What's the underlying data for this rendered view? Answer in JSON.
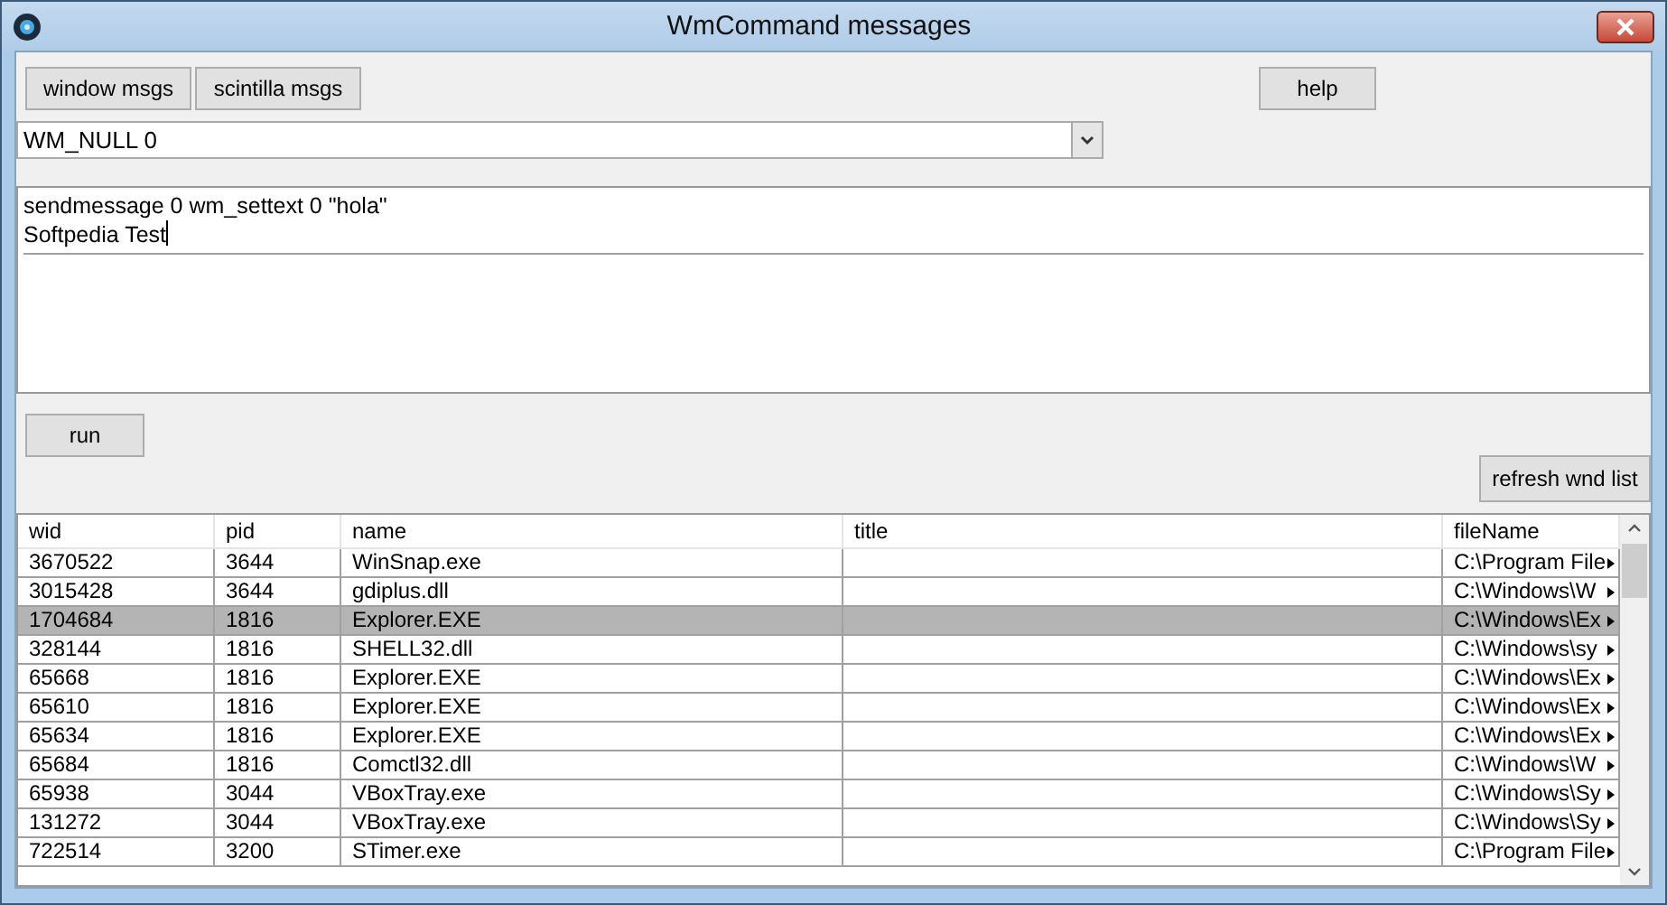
{
  "window": {
    "title": "WmCommand messages"
  },
  "top_buttons": [
    "window msgs",
    "scintilla msgs"
  ],
  "help_button": "help",
  "message_combo": {
    "value": "WM_NULL 0"
  },
  "script_editor": {
    "lines": [
      "sendmessage 0 wm_settext 0 \"hola\"",
      "Softpedia Test"
    ]
  },
  "run_button": "run",
  "refresh_button": "refresh wnd list",
  "table": {
    "columns": [
      "wid",
      "pid",
      "name",
      "title",
      "fileName"
    ],
    "rows": [
      {
        "cells": [
          "3670522",
          "3644",
          "WinSnap.exe",
          "",
          "C:\\Program File"
        ],
        "selected": false
      },
      {
        "cells": [
          "3015428",
          "3644",
          "gdiplus.dll",
          "",
          "C:\\Windows\\W"
        ],
        "selected": false
      },
      {
        "cells": [
          "1704684",
          "1816",
          "Explorer.EXE",
          "",
          "C:\\Windows\\Ex"
        ],
        "selected": true
      },
      {
        "cells": [
          "328144",
          "1816",
          "SHELL32.dll",
          "",
          "C:\\Windows\\sy"
        ],
        "selected": false
      },
      {
        "cells": [
          "65668",
          "1816",
          "Explorer.EXE",
          "",
          "C:\\Windows\\Ex"
        ],
        "selected": false
      },
      {
        "cells": [
          "65610",
          "1816",
          "Explorer.EXE",
          "",
          "C:\\Windows\\Ex"
        ],
        "selected": false
      },
      {
        "cells": [
          "65634",
          "1816",
          "Explorer.EXE",
          "",
          "C:\\Windows\\Ex"
        ],
        "selected": false
      },
      {
        "cells": [
          "65684",
          "1816",
          "Comctl32.dll",
          "",
          "C:\\Windows\\W"
        ],
        "selected": false
      },
      {
        "cells": [
          "65938",
          "3044",
          "VBoxTray.exe",
          "",
          "C:\\Windows\\Sy"
        ],
        "selected": false
      },
      {
        "cells": [
          "131272",
          "3044",
          "VBoxTray.exe",
          "",
          "C:\\Windows\\Sy"
        ],
        "selected": false
      },
      {
        "cells": [
          "722514",
          "3200",
          "STimer.exe",
          "",
          "C:\\Program File"
        ],
        "selected": false
      }
    ]
  }
}
